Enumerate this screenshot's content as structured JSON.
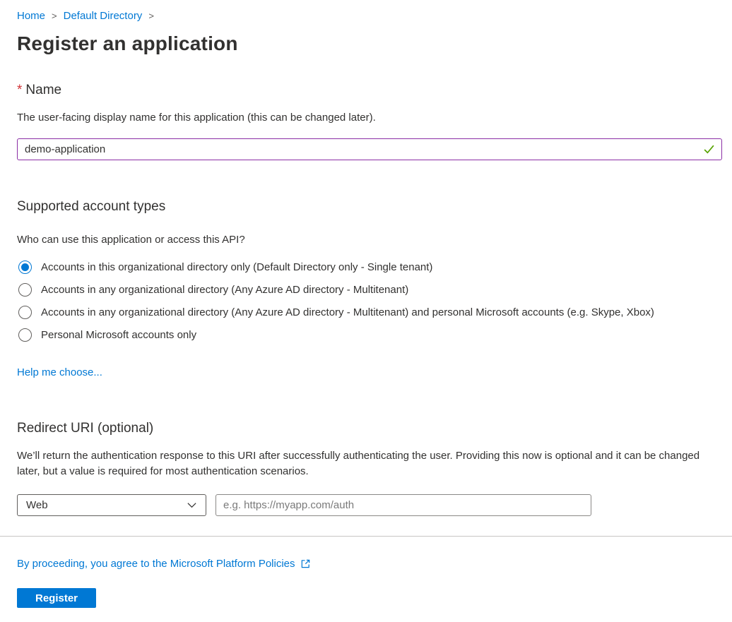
{
  "breadcrumb": {
    "items": [
      {
        "label": "Home"
      },
      {
        "label": "Default Directory"
      }
    ]
  },
  "page": {
    "title": "Register an application"
  },
  "name_section": {
    "required_marker": "*",
    "label": "Name",
    "description": "The user-facing display name for this application (this can be changed later).",
    "input_value": "demo-application",
    "validation_icon": "green-checkmark"
  },
  "account_types_section": {
    "heading": "Supported account types",
    "question": "Who can use this application or access this API?",
    "options": [
      {
        "label": "Accounts in this organizational directory only (Default Directory only - Single tenant)",
        "selected": true
      },
      {
        "label": "Accounts in any organizational directory (Any Azure AD directory - Multitenant)",
        "selected": false
      },
      {
        "label": "Accounts in any organizational directory (Any Azure AD directory - Multitenant) and personal Microsoft accounts (e.g. Skype, Xbox)",
        "selected": false
      },
      {
        "label": "Personal Microsoft accounts only",
        "selected": false
      }
    ],
    "help_link_label": "Help me choose..."
  },
  "redirect_section": {
    "heading": "Redirect URI (optional)",
    "description": "We’ll return the authentication response to this URI after successfully authenticating the user. Providing this now is optional and it can be changed later, but a value is required for most authentication scenarios.",
    "platform_selected": "Web",
    "uri_placeholder": "e.g. https://myapp.com/auth"
  },
  "footer": {
    "policy_link_label": "By proceeding, you agree to the Microsoft Platform Policies",
    "register_button_label": "Register"
  },
  "colors": {
    "link_blue": "#0078d4",
    "button_blue": "#0078d4",
    "radio_selected_blue": "#0078d4",
    "dirty_input_purple": "#8a2da5",
    "valid_green": "#57a300",
    "required_red": "#d13438",
    "text_dark": "#323130",
    "divider_gray": "#c8c6c4"
  }
}
